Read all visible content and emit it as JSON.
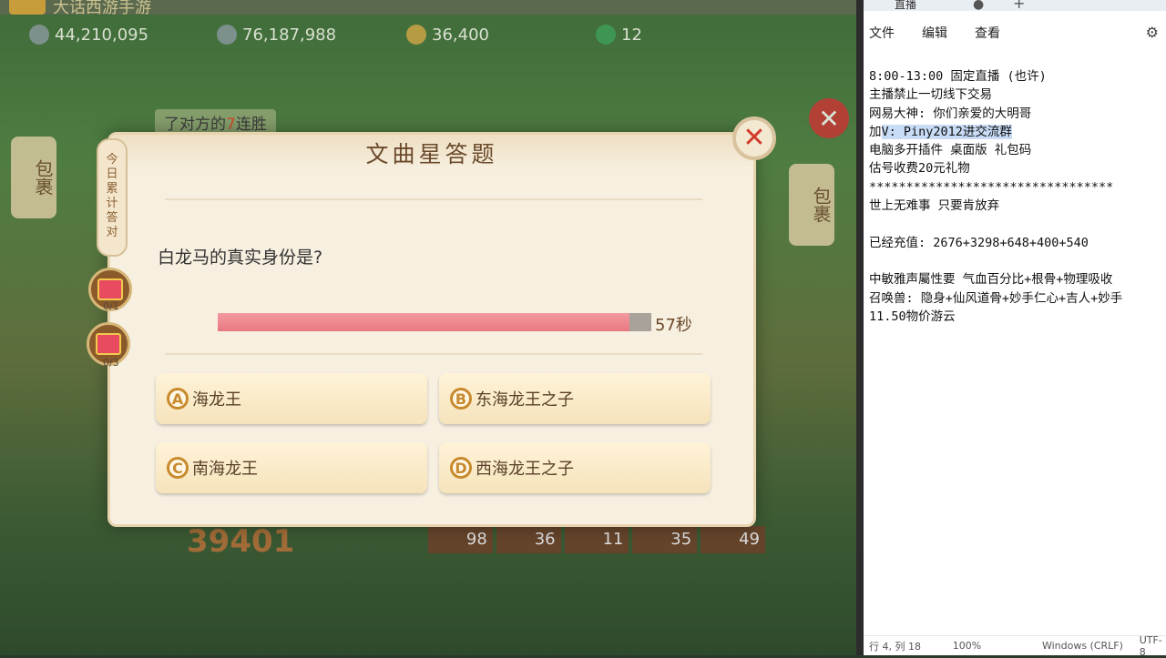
{
  "game": {
    "title": "大话西游手游",
    "resources": [
      {
        "value": "44,210,095",
        "icon": "silver-coin-icon"
      },
      {
        "value": "76,187,988",
        "icon": "silver-pile-icon"
      },
      {
        "value": "36,400",
        "icon": "gold-coin-icon"
      },
      {
        "value": "12",
        "icon": "jade-icon"
      }
    ],
    "notification": {
      "prefix": "了对方的",
      "count": "7",
      "suffix": "连胜"
    },
    "side_left": "包裹",
    "side_right": "包裹",
    "score": "39401",
    "bottom_counts": [
      "98",
      "36",
      "11",
      "35",
      "49"
    ]
  },
  "quiz": {
    "title": "文曲星答题",
    "ribbon_label": "今日累计答对",
    "gift1_count": "0/1",
    "gift2_count": "0/3",
    "question": "白龙马的真实身份是?",
    "timer_text": "57秒",
    "timer_fraction": 0.95,
    "options": [
      {
        "letter": "A",
        "text": "海龙王"
      },
      {
        "letter": "B",
        "text": "东海龙王之子"
      },
      {
        "letter": "C",
        "text": "南海龙王"
      },
      {
        "letter": "D",
        "text": "西海龙王之子"
      }
    ]
  },
  "notepad": {
    "tab": "直播",
    "menu": [
      "文件",
      "编辑",
      "查看"
    ],
    "lines": [
      "8:00-13:00 固定直播 (也许)",
      "主播禁止一切线下交易",
      "网易大神: 你们亲爱的大明哥",
      "加V: Piny2012进交流群",
      "电脑多开插件 桌面版 礼包码",
      "估号收费20元礼物",
      "*********************************",
      "世上无难事 只要肯放弃",
      "",
      "已经充值: 2676+3298+648+400+540",
      "",
      "中敏雅声屬性要 气血百分比+根骨+物理吸收",
      "召唤兽: 隐身+仙风道骨+妙手仁心+吉人+妙手",
      "11.50物价游云"
    ],
    "status": {
      "position": "行 4, 列 18",
      "zoom": "100%",
      "eol": "Windows (CRLF)",
      "encoding": "UTF-8"
    }
  }
}
